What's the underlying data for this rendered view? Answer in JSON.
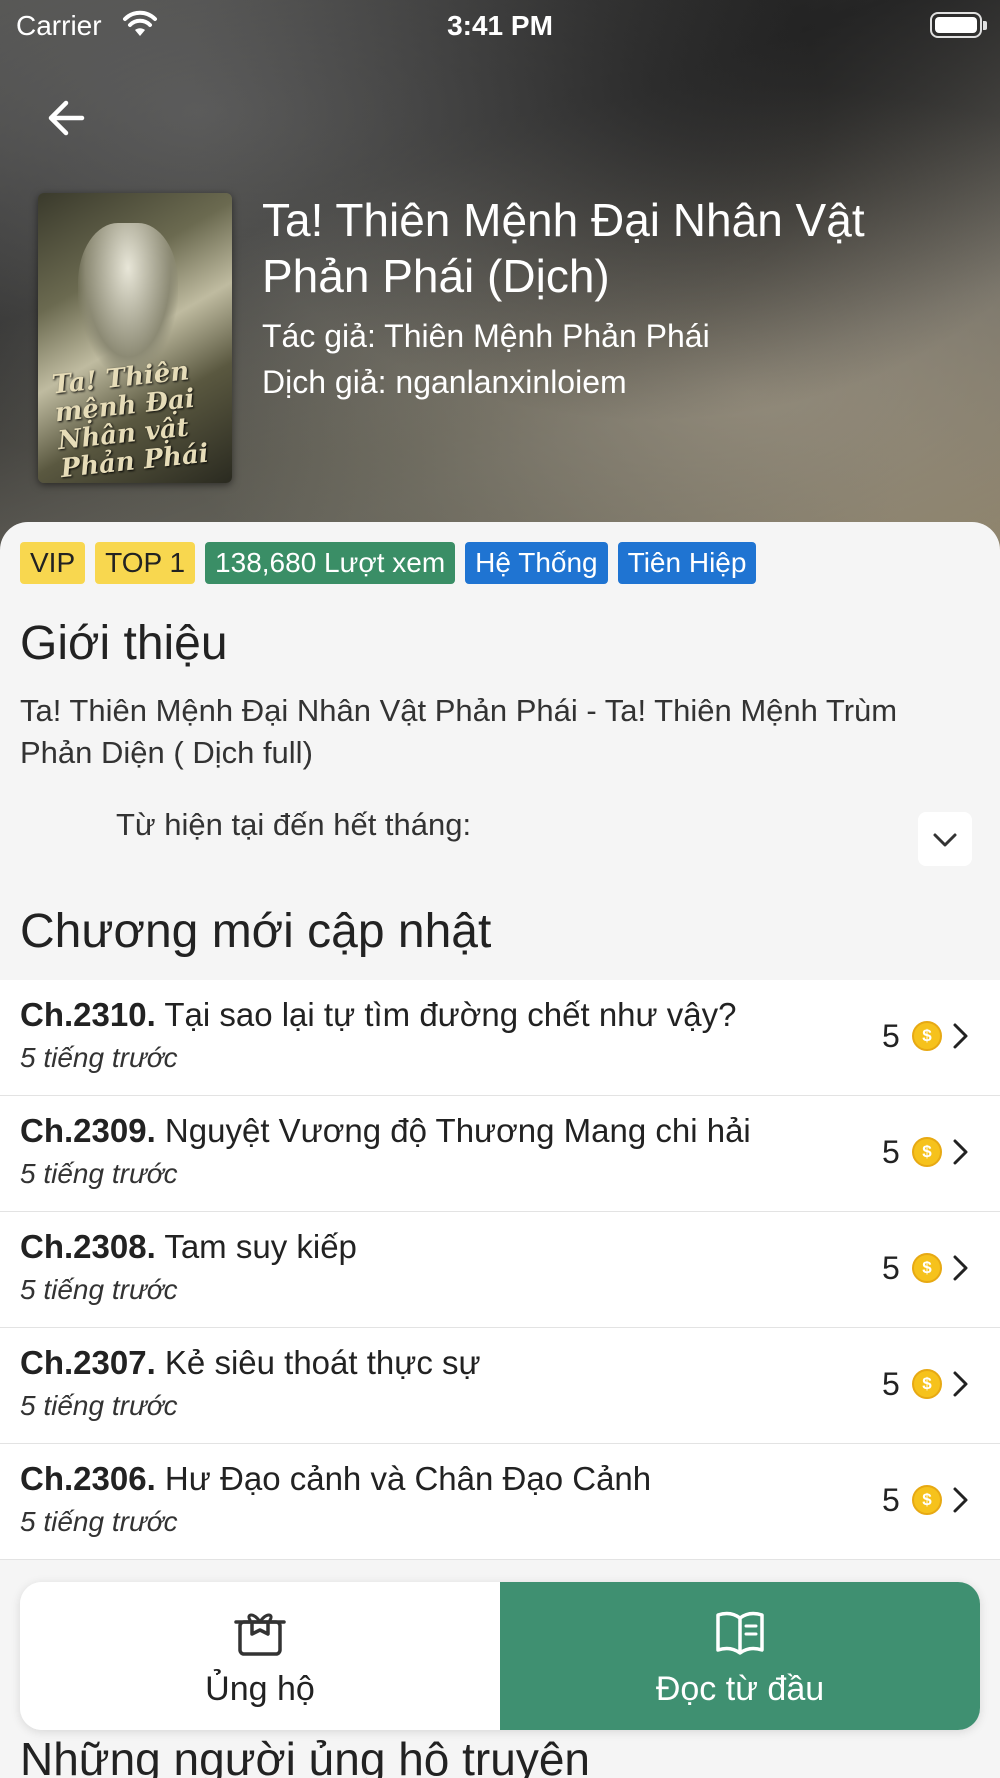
{
  "status_bar": {
    "carrier": "Carrier",
    "time": "3:41 PM"
  },
  "book": {
    "title": "Ta! Thiên Mệnh Đại Nhân Vật Phản Phái (Dịch)",
    "author": "Tác giả: Thiên Mệnh Phản Phái",
    "translator": "Dịch giả: nganlanxinloiem",
    "cover_text": "Ta! Thiên mệnh Đại Nhân vật Phản Phái"
  },
  "tags": [
    "VIP",
    "TOP 1",
    "138,680 Lượt xem",
    "Hệ Thống",
    "Tiên Hiệp"
  ],
  "intro": {
    "heading": "Giới thiệu",
    "text": "Ta! Thiên Mệnh Đại Nhân Vật Phản Phái - Ta! Thiên Mệnh Trùm Phản Diện ( Dịch full)",
    "sub": "Từ hiện tại đến hết tháng:"
  },
  "chapters_heading": "Chương mới cập nhật",
  "chapters": [
    {
      "number": "Ch.2310.",
      "title": "Tại sao lại tự tìm đường chết như vậy?",
      "time": "5 tiếng trước",
      "price": "5"
    },
    {
      "number": "Ch.2309.",
      "title": "Nguyệt Vương độ Thương Mang chi hải",
      "time": "5 tiếng trước",
      "price": "5"
    },
    {
      "number": "Ch.2308.",
      "title": "Tam suy kiếp",
      "time": "5 tiếng trước",
      "price": "5"
    },
    {
      "number": "Ch.2307.",
      "title": "Kẻ siêu thoát thực sự",
      "time": "5 tiếng trước",
      "price": "5"
    },
    {
      "number": "Ch.2306.",
      "title": "Hư Đạo cảnh và Chân Đạo Cảnh",
      "time": "5 tiếng trước",
      "price": "5"
    }
  ],
  "actions": {
    "support": "Ủng hộ",
    "read": "Đọc từ đầu"
  },
  "supporters_heading": "Những người ủng hộ truyện",
  "colors": {
    "tag_yellow": "#f8d74f",
    "tag_green": "#3a8e66",
    "tag_blue": "#1f74d2",
    "read_button": "#3f9071",
    "coin": "#f6c21c"
  }
}
